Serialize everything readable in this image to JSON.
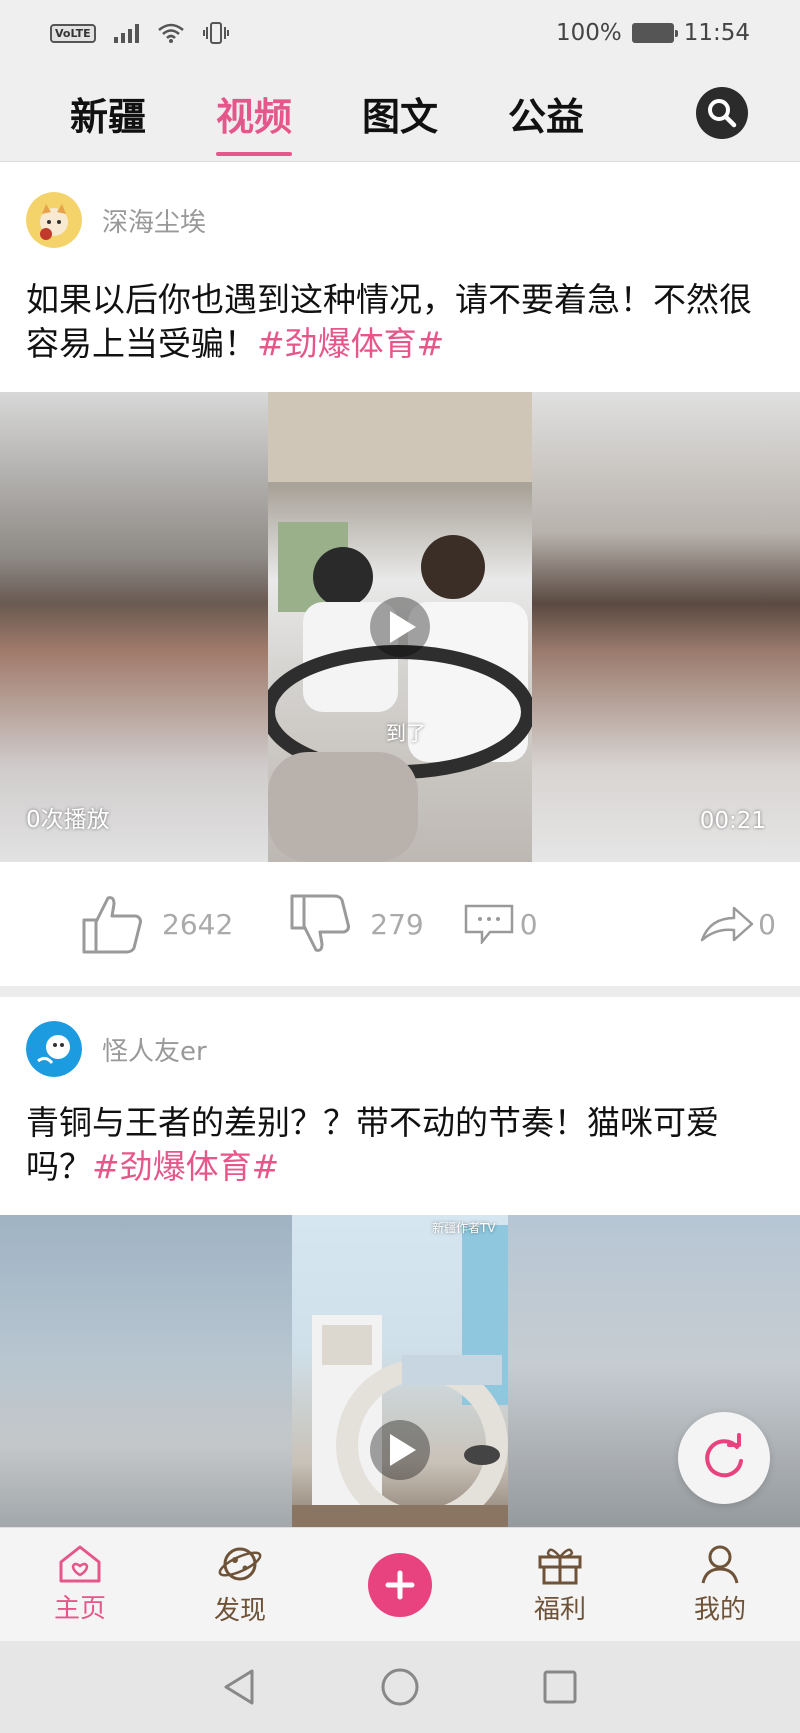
{
  "status_bar": {
    "volte": "VoLTE",
    "battery": "100%",
    "time": "11:54"
  },
  "tabs": [
    {
      "label": "新疆",
      "active": false
    },
    {
      "label": "视频",
      "active": true
    },
    {
      "label": "图文",
      "active": false
    },
    {
      "label": "公益",
      "active": false
    }
  ],
  "posts": [
    {
      "author": "深海尘埃",
      "title": "如果以后你也遇到这种情况，请不要着急！不然很容易上当受骗！",
      "hashtag": "#劲爆体育#",
      "plays": "0次播放",
      "duration": "00:21",
      "subtitle": "到了",
      "likes": "2642",
      "dislikes": "279",
      "comments": "0",
      "shares": "0"
    },
    {
      "author": "怪人友er",
      "title": "青铜与王者的差别？？带不动的节奏！猫咪可爱吗？",
      "hashtag": "#劲爆体育#",
      "watermark": "新疆作者TV"
    }
  ],
  "bottom_nav": [
    {
      "label": "主页",
      "icon": "home-icon",
      "active": true
    },
    {
      "label": "发现",
      "icon": "planet-icon",
      "active": false
    },
    {
      "label": "",
      "icon": "plus-icon",
      "active": false
    },
    {
      "label": "福利",
      "icon": "gift-icon",
      "active": false
    },
    {
      "label": "我的",
      "icon": "user-icon",
      "active": false
    }
  ],
  "colors": {
    "accent": "#e5578a",
    "nav_text": "#6e5338"
  }
}
